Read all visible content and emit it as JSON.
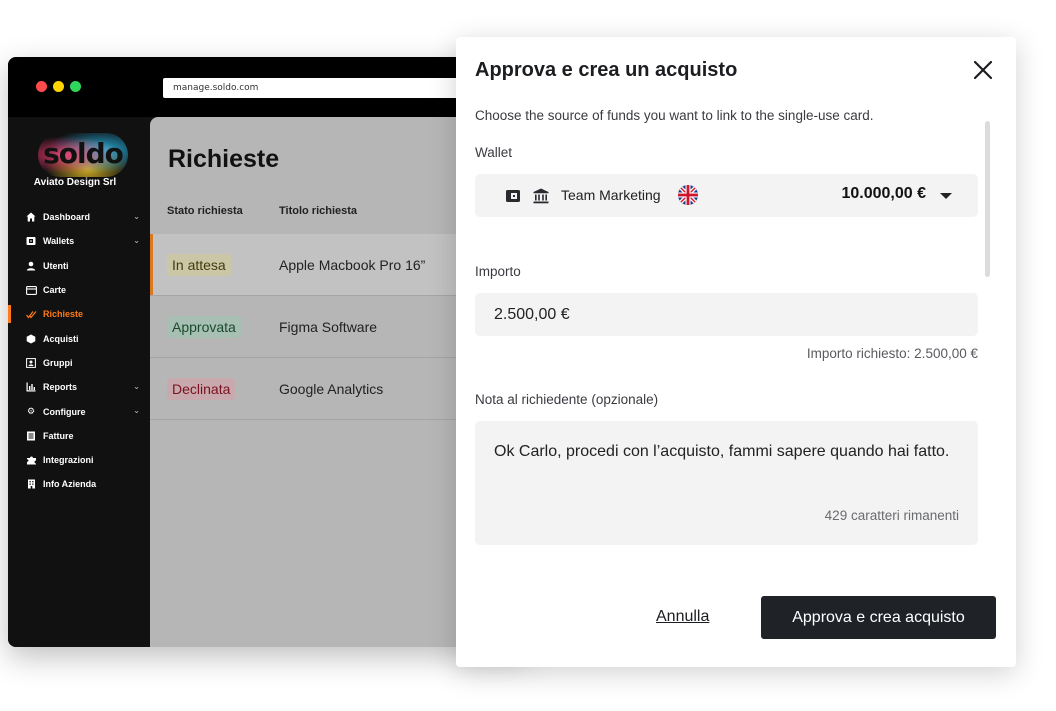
{
  "browser": {
    "url": "manage.soldo.com"
  },
  "sidebar": {
    "logo_text": "soldo",
    "company_name": "Aviato Design Srl",
    "items": [
      {
        "label": "Dashboard",
        "icon": "home-icon",
        "expandable": true
      },
      {
        "label": "Wallets",
        "icon": "wallet-icon",
        "expandable": true
      },
      {
        "label": "Utenti",
        "icon": "user-icon",
        "expandable": false
      },
      {
        "label": "Carte",
        "icon": "card-icon",
        "expandable": false
      },
      {
        "label": "Richieste",
        "icon": "requests-icon",
        "expandable": false,
        "active": true
      },
      {
        "label": "Acquisti",
        "icon": "purchase-icon",
        "expandable": false
      },
      {
        "label": "Gruppi",
        "icon": "groups-icon",
        "expandable": false
      },
      {
        "label": "Reports",
        "icon": "chart-icon",
        "expandable": true
      },
      {
        "label": "Configure",
        "icon": "gear-icon",
        "expandable": true
      },
      {
        "label": "Fatture",
        "icon": "invoice-icon",
        "expandable": false
      },
      {
        "label": "Integrazioni",
        "icon": "puzzle-icon",
        "expandable": false
      },
      {
        "label": "Info Azienda",
        "icon": "building-icon",
        "expandable": false
      }
    ]
  },
  "main": {
    "title": "Richieste",
    "columns": [
      "Stato richiesta",
      "Titolo richiesta"
    ],
    "rows": [
      {
        "status": "In attesa",
        "title": "Apple Macbook Pro 16”"
      },
      {
        "status": "Approvata",
        "title": "Figma Software"
      },
      {
        "status": "Declinata",
        "title": "Google Analytics"
      }
    ]
  },
  "modal": {
    "title": "Approva e crea un acquisto",
    "description": "Choose the source of funds you want to link to the single-use card.",
    "wallet_label": "Wallet",
    "wallet": {
      "name": "Team Marketing",
      "balance": "10.000,00 €"
    },
    "amount_label": "Importo",
    "amount_value": "2.500,00 €",
    "requested_amount": "Importo richiesto: 2.500,00 €",
    "note_label": "Nota al richiedente (opzionale)",
    "note_value": "Ok Carlo, procedi con l’acquisto, fammi sapere quando hai fatto.",
    "remaining_chars": "429 caratteri rimanenti",
    "cancel_label": "Annulla",
    "confirm_label": "Approva e crea acquisto"
  },
  "colors": {
    "accent_orange": "#ff7a1a",
    "primary_button": "#1f2328",
    "status_pending": "#cbc6a6",
    "status_approved": "#a8bfb4",
    "status_declined": "#c8aaae"
  }
}
